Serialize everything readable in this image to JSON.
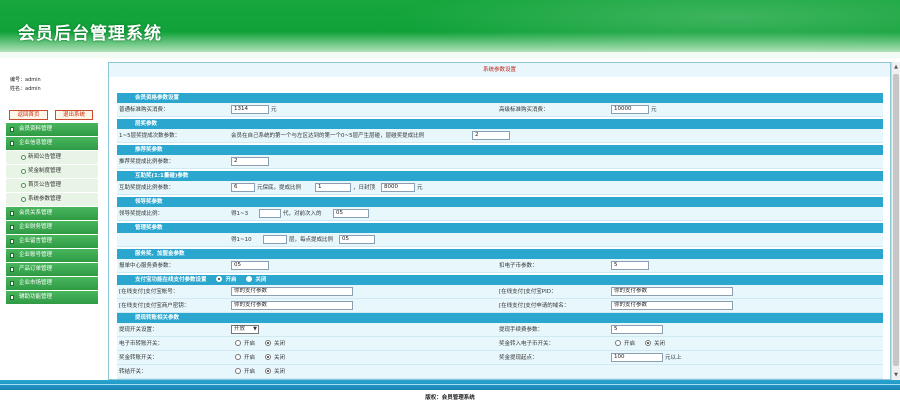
{
  "app": {
    "title": "会员后台管理系统"
  },
  "user": {
    "id_label": "编号：",
    "id_value": "admin",
    "name_label": "姓名：",
    "name_value": "admin"
  },
  "side_buttons": {
    "home": "返回首页",
    "logout": "退出系统"
  },
  "menu": [
    {
      "label": "会员资料管理",
      "type": "group"
    },
    {
      "label": "企业信息管理",
      "type": "group"
    },
    {
      "label": "新闻公告管理",
      "type": "sub"
    },
    {
      "label": "奖金制度管理",
      "type": "sub"
    },
    {
      "label": "首页公告管理",
      "type": "sub"
    },
    {
      "label": "系统参数管理",
      "type": "sub"
    },
    {
      "label": "会员关系管理",
      "type": "group"
    },
    {
      "label": "企业财务管理",
      "type": "group"
    },
    {
      "label": "企业留言管理",
      "type": "group"
    },
    {
      "label": "企业账号管理",
      "type": "group"
    },
    {
      "label": "产品订单管理",
      "type": "group"
    },
    {
      "label": "企业市场管理",
      "type": "group"
    },
    {
      "label": "辅助功能管理",
      "type": "group"
    }
  ],
  "main": {
    "title": "系统参数设置"
  },
  "form": {
    "sec_member": "会员资格参数设置",
    "r1": {
      "label": "普通标准购买消费：",
      "value": "1314",
      "unit": "元",
      "label2": "高级标准购买消费：",
      "value2": "10000",
      "unit2": "元"
    },
    "sec_layer": "层奖参数",
    "r2": {
      "label": "1~5层奖提成次数参数：",
      "text": "会员在自己系统的第一个与左区达到的第一个0~5层产生层碰，层碰奖提成比例",
      "value": "2"
    },
    "sec_recommend": "推荐奖参数",
    "r3": {
      "label": "推荐奖提成比例参数：",
      "value": "2"
    },
    "sec_mutual": "互助奖(1:1量碰)参数",
    "r4": {
      "label": "互助奖提成比例参数：",
      "value": "6",
      "t1": "元保底，提成比例",
      "value2": "1",
      "t2": "，日封顶",
      "value3": "8000",
      "t3": "元"
    },
    "sec_lead": "领导奖参数",
    "r5": {
      "label": "领导奖提成比例：",
      "t1": "得1~3",
      "t2": "代，对前次入的",
      "value": "05"
    },
    "sec_manage": "管理奖参数",
    "r6": {
      "t1": "得1~10",
      "t2": "层，每点提成比例",
      "value": "05"
    },
    "sec_service": "服务奖、加盟金参数",
    "r7": {
      "label": "报单中心服务费参数：",
      "value": "05",
      "label2": "扣电子币参数：",
      "value2": "5"
    },
    "sec_pay": "支付宝功能在线支付参数设置",
    "pay_on": "开启",
    "pay_off": "关闭",
    "r8": {
      "label": "[在线支付]支付宝帐号：",
      "value": "你的支付参数",
      "label2": "[在线支付]支付宝PID：",
      "value2": "你的支付参数"
    },
    "r9": {
      "label": "[在线支付]支付宝商户密钥：",
      "value": "你的支付参数",
      "label2": "[在线支付]支付申请的域名：",
      "value2": "你的支付参数"
    },
    "sec_transfer": "提现转账相关参数",
    "r10": {
      "label": "提现开关设置：",
      "select": "开放",
      "label2": "提现手续费参数：",
      "value2": "5"
    },
    "r11": {
      "label": "电子币转账开关：",
      "on": "开启",
      "off": "关闭",
      "label2": "奖金转入电子币开关：",
      "on2": "开启",
      "off2": "关闭"
    },
    "r12": {
      "label": "奖金转账开关：",
      "on": "开启",
      "off": "关闭",
      "label2": "奖金提现起点：",
      "value2": "100",
      "unit2": "元以上"
    },
    "r13": {
      "label": "转结开关：",
      "on": "开启",
      "off": "关闭"
    }
  },
  "footer": {
    "text": "版权：会员管理系统"
  }
}
